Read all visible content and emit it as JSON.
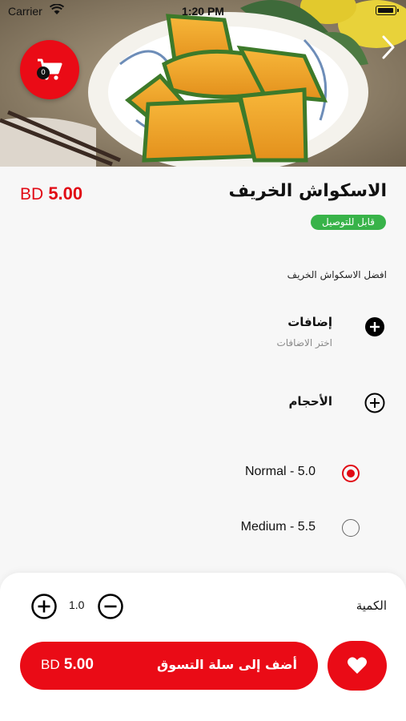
{
  "status_bar": {
    "carrier": "Carrier",
    "time": "1:20 PM"
  },
  "header": {
    "cart_count": "0",
    "icons": [
      "cart-icon",
      "chevron-right-icon"
    ]
  },
  "product": {
    "name": "الاسكواش الخريف",
    "price_value": "5.00",
    "currency": "BD",
    "delivery_badge": "قابل للتوصيل",
    "description": "افضل الاسكواش الخريف"
  },
  "addons": {
    "title": "إضافات",
    "subtitle": "اختر الاضافات"
  },
  "sizes": {
    "title": "الأحجام",
    "options": [
      {
        "label": "Normal - 5.0",
        "selected": true
      },
      {
        "label": "Medium - 5.5",
        "selected": false
      }
    ]
  },
  "quantity": {
    "label": "الكمية",
    "value": "1.0"
  },
  "add_to_cart": {
    "label": "أضف إلى سلة التسوق",
    "price_value": "5.00",
    "currency": "BD"
  },
  "colors": {
    "accent": "#ea0b16",
    "badge_green": "#38b349"
  }
}
